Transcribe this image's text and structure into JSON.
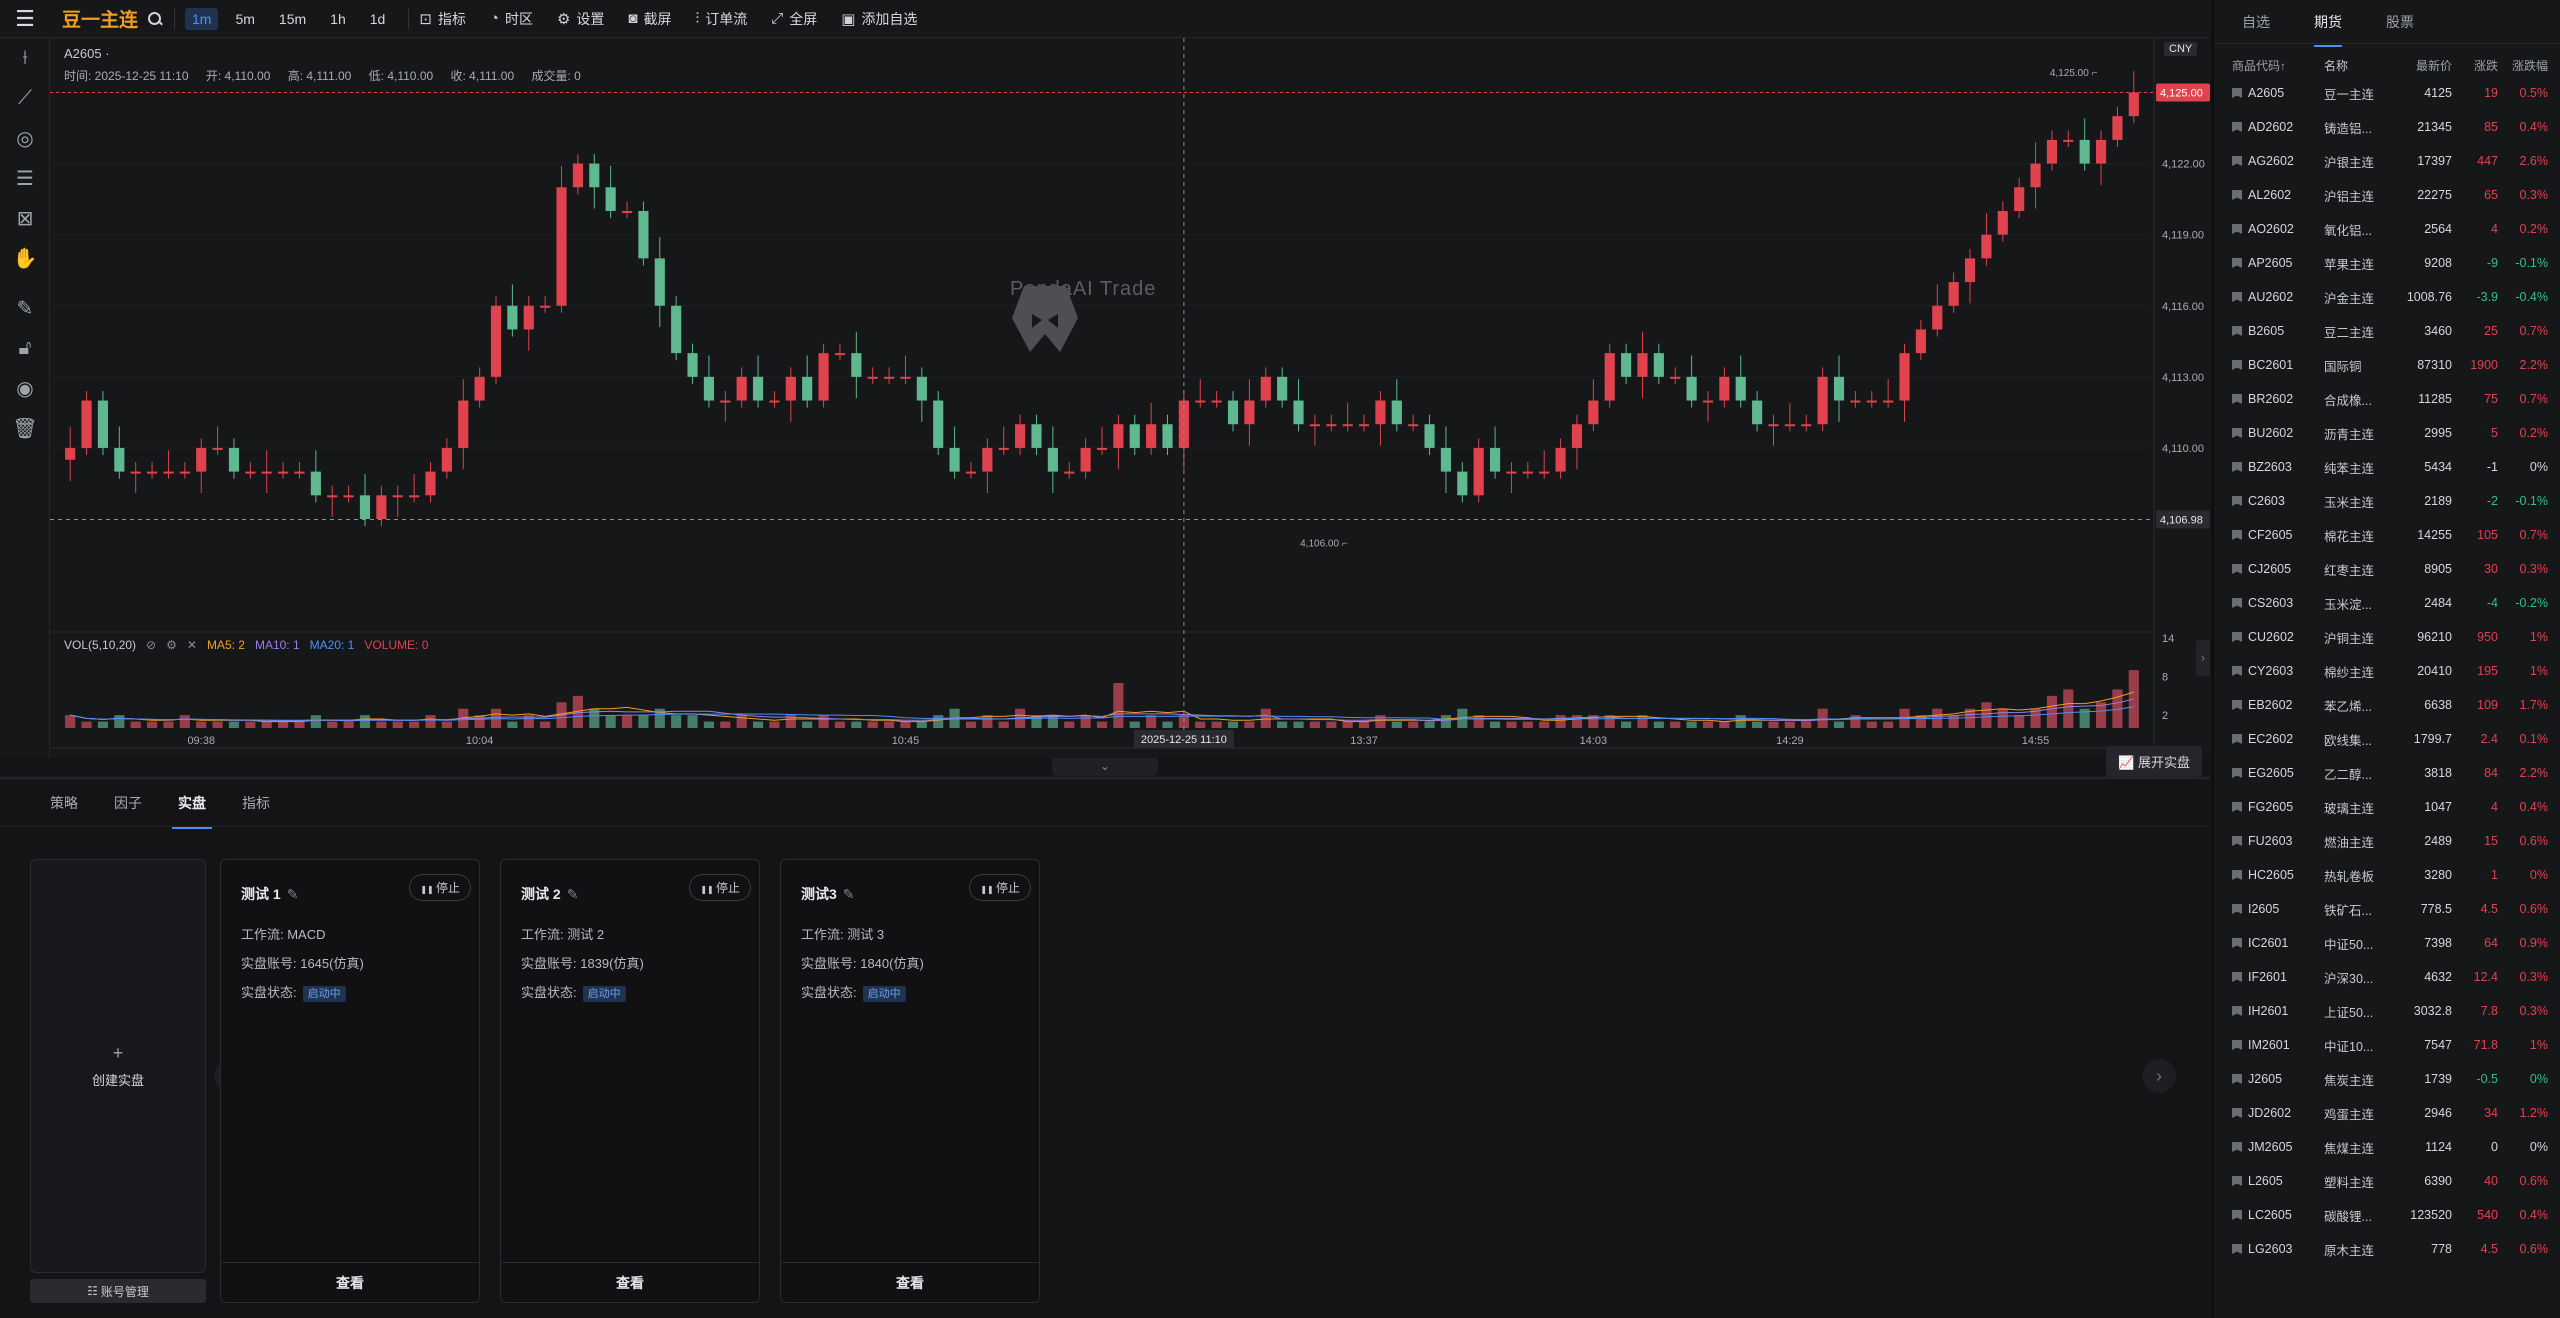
{
  "topbar": {
    "symbol": "豆一主连",
    "timeframes": [
      "1m",
      "5m",
      "15m",
      "1h",
      "1d"
    ],
    "active_timeframe": "1m",
    "buttons": [
      {
        "icon": "indicator-icon",
        "label": "指标"
      },
      {
        "icon": "region-icon",
        "label": "时区"
      },
      {
        "icon": "gear-icon",
        "label": "设置"
      },
      {
        "icon": "camera-icon",
        "label": "截屏"
      },
      {
        "icon": "orderflow-icon",
        "label": "订单流"
      },
      {
        "icon": "fullscreen-icon",
        "label": "全屏"
      },
      {
        "icon": "add-favorite-icon",
        "label": "添加自选"
      }
    ]
  },
  "legend": {
    "symbol": "A2605 ·",
    "time": "时间: 2025-12-25 11:10",
    "open": "开: 4,110.00",
    "high": "高: 4,111.00",
    "low": "低: 4,110.00",
    "close": "收: 4,111.00",
    "volume": "成交量: 0"
  },
  "vol_legend": {
    "title": "VOL(5,10,20)",
    "ma5": "MA5: 2",
    "ma10": "MA10: 1",
    "ma20": "MA20: 1",
    "volume": "VOLUME: 0"
  },
  "currency": "CNY",
  "watermark": "PandaAI Trade",
  "expand_live": "展开实盘",
  "chart_data": {
    "type": "candlestick",
    "y_ticks": [
      4110,
      4113,
      4116,
      4119,
      4122,
      4125
    ],
    "y_tick_labels": [
      "4,110.00",
      "4,113.00",
      "4,116.00",
      "4,119.00",
      "4,122.00",
      "4,125.00"
    ],
    "ylim": [
      4102.4,
      4127.3
    ],
    "x_tick_labels": [
      "09:38",
      "10:04",
      "10:45",
      "11:10",
      "13:37",
      "14:03",
      "14:29",
      "14:55"
    ],
    "crosshair_time": "2025-12-25 11:10",
    "last_price_label": "4,125.00",
    "crosshair_price_label": "4,106.98",
    "high_marker": "4,125.00",
    "low_marker": "4,106.00",
    "vol_ticks": [
      2,
      8,
      14
    ],
    "closes": [
      4110,
      4112,
      4110,
      4109,
      4109,
      4109,
      4109,
      4109,
      4110,
      4110,
      4109,
      4109,
      4109,
      4109,
      4109,
      4108,
      4108,
      4108,
      4107,
      4108,
      4108,
      4108,
      4109,
      4110,
      4112,
      4113,
      4116,
      4115,
      4116,
      4116,
      4121,
      4122,
      4121,
      4120,
      4120,
      4118,
      4116,
      4114,
      4113,
      4112,
      4112,
      4113,
      4112,
      4112,
      4113,
      4112,
      4114,
      4114,
      4113,
      4113,
      4113,
      4113,
      4112,
      4110,
      4109,
      4109,
      4110,
      4110,
      4111,
      4110,
      4109,
      4109,
      4110,
      4110,
      4111,
      4110,
      4111,
      4110,
      4112,
      4112,
      4112,
      4111,
      4112,
      4113,
      4112,
      4111,
      4111,
      4111,
      4111,
      4111,
      4112,
      4111,
      4111,
      4110,
      4109,
      4108,
      4110,
      4109,
      4109,
      4109,
      4109,
      4110,
      4111,
      4112,
      4114,
      4113,
      4114,
      4113,
      4113,
      4112,
      4112,
      4113,
      4112,
      4111,
      4111,
      4111,
      4111,
      4113,
      4112,
      4112,
      4112,
      4112,
      4114,
      4115,
      4116,
      4117,
      4118,
      4119,
      4120,
      4121,
      4122,
      4123,
      4123,
      4122,
      4123,
      4124,
      4125
    ],
    "volumes": [
      2,
      1,
      1,
      2,
      1,
      1,
      1,
      2,
      1,
      1,
      1,
      1,
      1,
      1,
      1,
      2,
      1,
      1,
      2,
      1,
      1,
      1,
      2,
      1,
      3,
      2,
      3,
      1,
      2,
      1,
      4,
      5,
      3,
      2,
      2,
      2,
      3,
      2,
      2,
      1,
      1,
      2,
      1,
      1,
      2,
      1,
      2,
      1,
      1,
      1,
      1,
      1,
      1,
      2,
      3,
      1,
      2,
      1,
      3,
      2,
      2,
      1,
      2,
      1,
      7,
      1,
      2,
      1,
      2,
      1,
      1,
      1,
      1,
      3,
      1,
      1,
      1,
      1,
      1,
      1,
      2,
      1,
      1,
      1,
      2,
      3,
      2,
      1,
      1,
      1,
      1,
      2,
      2,
      2,
      2,
      1,
      2,
      1,
      1,
      1,
      1,
      1,
      2,
      1,
      1,
      1,
      1,
      3,
      1,
      2,
      1,
      1,
      3,
      2,
      3,
      2,
      3,
      4,
      3,
      2,
      3,
      5,
      6,
      3,
      4,
      6,
      9
    ]
  },
  "left_tools": [
    "crosshair-icon",
    "trendline-icon",
    "circle-tool-icon",
    "fib-icon",
    "pattern-icon",
    "hand-icon",
    "ruler-icon",
    "lock-icon",
    "eye-icon",
    "trash-icon"
  ],
  "right_panel": {
    "tabs": [
      "自选",
      "期货",
      "股票"
    ],
    "active_tab": "期货",
    "headers": {
      "code": "商品代码↑",
      "name": "名称",
      "price": "最新价",
      "chg": "涨跌",
      "pct": "涨跌幅"
    },
    "rows": [
      {
        "code": "A2605",
        "name": "豆一主连",
        "price": "4125",
        "chg": "19",
        "pct": "0.5%",
        "dir": "up"
      },
      {
        "code": "AD2602",
        "name": "铸造铝...",
        "price": "21345",
        "chg": "85",
        "pct": "0.4%",
        "dir": "up"
      },
      {
        "code": "AG2602",
        "name": "沪银主连",
        "price": "17397",
        "chg": "447",
        "pct": "2.6%",
        "dir": "up"
      },
      {
        "code": "AL2602",
        "name": "沪铝主连",
        "price": "22275",
        "chg": "65",
        "pct": "0.3%",
        "dir": "up"
      },
      {
        "code": "AO2602",
        "name": "氧化铝...",
        "price": "2564",
        "chg": "4",
        "pct": "0.2%",
        "dir": "up"
      },
      {
        "code": "AP2605",
        "name": "苹果主连",
        "price": "9208",
        "chg": "-9",
        "pct": "-0.1%",
        "dir": "down"
      },
      {
        "code": "AU2602",
        "name": "沪金主连",
        "price": "1008.76",
        "chg": "-3.9",
        "pct": "-0.4%",
        "dir": "down"
      },
      {
        "code": "B2605",
        "name": "豆二主连",
        "price": "3460",
        "chg": "25",
        "pct": "0.7%",
        "dir": "up"
      },
      {
        "code": "BC2601",
        "name": "国际铜",
        "price": "87310",
        "chg": "1900",
        "pct": "2.2%",
        "dir": "up"
      },
      {
        "code": "BR2602",
        "name": "合成橡...",
        "price": "11285",
        "chg": "75",
        "pct": "0.7%",
        "dir": "up"
      },
      {
        "code": "BU2602",
        "name": "沥青主连",
        "price": "2995",
        "chg": "5",
        "pct": "0.2%",
        "dir": "up"
      },
      {
        "code": "BZ2603",
        "name": "纯苯主连",
        "price": "5434",
        "chg": "-1",
        "pct": "0%",
        "dir": "flat"
      },
      {
        "code": "C2603",
        "name": "玉米主连",
        "price": "2189",
        "chg": "-2",
        "pct": "-0.1%",
        "dir": "down"
      },
      {
        "code": "CF2605",
        "name": "棉花主连",
        "price": "14255",
        "chg": "105",
        "pct": "0.7%",
        "dir": "up"
      },
      {
        "code": "CJ2605",
        "name": "红枣主连",
        "price": "8905",
        "chg": "30",
        "pct": "0.3%",
        "dir": "up"
      },
      {
        "code": "CS2603",
        "name": "玉米淀...",
        "price": "2484",
        "chg": "-4",
        "pct": "-0.2%",
        "dir": "down"
      },
      {
        "code": "CU2602",
        "name": "沪铜主连",
        "price": "96210",
        "chg": "950",
        "pct": "1%",
        "dir": "up"
      },
      {
        "code": "CY2603",
        "name": "棉纱主连",
        "price": "20410",
        "chg": "195",
        "pct": "1%",
        "dir": "up"
      },
      {
        "code": "EB2602",
        "name": "苯乙烯...",
        "price": "6638",
        "chg": "109",
        "pct": "1.7%",
        "dir": "up"
      },
      {
        "code": "EC2602",
        "name": "欧线集...",
        "price": "1799.7",
        "chg": "2.4",
        "pct": "0.1%",
        "dir": "up"
      },
      {
        "code": "EG2605",
        "name": "乙二醇...",
        "price": "3818",
        "chg": "84",
        "pct": "2.2%",
        "dir": "up"
      },
      {
        "code": "FG2605",
        "name": "玻璃主连",
        "price": "1047",
        "chg": "4",
        "pct": "0.4%",
        "dir": "up"
      },
      {
        "code": "FU2603",
        "name": "燃油主连",
        "price": "2489",
        "chg": "15",
        "pct": "0.6%",
        "dir": "up"
      },
      {
        "code": "HC2605",
        "name": "热轧卷板",
        "price": "3280",
        "chg": "1",
        "pct": "0%",
        "dir": "up"
      },
      {
        "code": "I2605",
        "name": "铁矿石...",
        "price": "778.5",
        "chg": "4.5",
        "pct": "0.6%",
        "dir": "up"
      },
      {
        "code": "IC2601",
        "name": "中证50...",
        "price": "7398",
        "chg": "64",
        "pct": "0.9%",
        "dir": "up"
      },
      {
        "code": "IF2601",
        "name": "沪深30...",
        "price": "4632",
        "chg": "12.4",
        "pct": "0.3%",
        "dir": "up"
      },
      {
        "code": "IH2601",
        "name": "上证50...",
        "price": "3032.8",
        "chg": "7.8",
        "pct": "0.3%",
        "dir": "up"
      },
      {
        "code": "IM2601",
        "name": "中证10...",
        "price": "7547",
        "chg": "71.8",
        "pct": "1%",
        "dir": "up"
      },
      {
        "code": "J2605",
        "name": "焦炭主连",
        "price": "1739",
        "chg": "-0.5",
        "pct": "0%",
        "dir": "down"
      },
      {
        "code": "JD2602",
        "name": "鸡蛋主连",
        "price": "2946",
        "chg": "34",
        "pct": "1.2%",
        "dir": "up"
      },
      {
        "code": "JM2605",
        "name": "焦煤主连",
        "price": "1124",
        "chg": "0",
        "pct": "0%",
        "dir": "flat"
      },
      {
        "code": "L2605",
        "name": "塑料主连",
        "price": "6390",
        "chg": "40",
        "pct": "0.6%",
        "dir": "up"
      },
      {
        "code": "LC2605",
        "name": "碳酸锂...",
        "price": "123520",
        "chg": "540",
        "pct": "0.4%",
        "dir": "up"
      },
      {
        "code": "LG2603",
        "name": "原木主连",
        "price": "778",
        "chg": "4.5",
        "pct": "0.6%",
        "dir": "up"
      }
    ]
  },
  "bottom": {
    "tabs": [
      "策略",
      "因子",
      "实盘",
      "指标"
    ],
    "active_tab": "实盘",
    "create_label": "创建实盘",
    "account_btn": "账号管理",
    "cards": [
      {
        "title": "测试 1",
        "stop": "停止",
        "workflow": "工作流: MACD",
        "account": "实盘账号: 1645(仿真)",
        "status_label": "实盘状态:",
        "status": "启动中",
        "view": "查看"
      },
      {
        "title": "测试 2",
        "stop": "停止",
        "workflow": "工作流: 测试 2",
        "account": "实盘账号: 1839(仿真)",
        "status_label": "实盘状态:",
        "status": "启动中",
        "view": "查看"
      },
      {
        "title": "测试3",
        "stop": "停止",
        "workflow": "工作流: 测试 3",
        "account": "实盘账号: 1840(仿真)",
        "status_label": "实盘状态:",
        "status": "启动中",
        "view": "查看"
      }
    ]
  },
  "colors": {
    "up": "#e0424e",
    "down": "#48b585",
    "accent": "#4d8ff7",
    "symbol": "#f0a020"
  }
}
